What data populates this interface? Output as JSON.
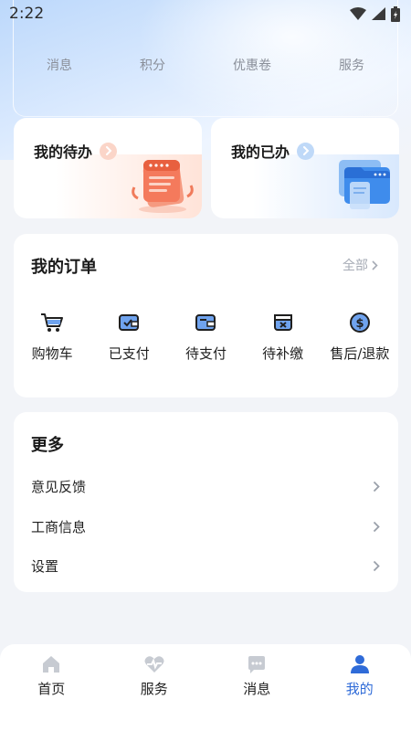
{
  "status_bar": {
    "time": "2:22"
  },
  "stats": [
    "消息",
    "积分",
    "优惠卷",
    "服务"
  ],
  "task_cards": {
    "todo": {
      "title": "我的待办"
    },
    "done": {
      "title": "我的已办"
    }
  },
  "orders": {
    "title": "我的订单",
    "all_label": "全部",
    "items": [
      {
        "label": "购物车",
        "icon": "shopping-cart-icon"
      },
      {
        "label": "已支付",
        "icon": "wallet-check-icon"
      },
      {
        "label": "待支付",
        "icon": "wallet-icon"
      },
      {
        "label": "待补缴",
        "icon": "wallet-close-icon"
      },
      {
        "label": "售后/退款",
        "icon": "dollar-circle-icon"
      }
    ]
  },
  "more": {
    "title": "更多",
    "items": [
      {
        "label": "意见反馈"
      },
      {
        "label": "工商信息"
      },
      {
        "label": "设置"
      }
    ]
  },
  "tabbar": {
    "active": "我的",
    "accent": "#2f6bd8",
    "tabs": [
      {
        "label": "首页",
        "icon": "home-icon"
      },
      {
        "label": "服务",
        "icon": "heart-pulse-icon"
      },
      {
        "label": "消息",
        "icon": "chat-bubble-icon"
      },
      {
        "label": "我的",
        "icon": "user-icon"
      }
    ]
  }
}
